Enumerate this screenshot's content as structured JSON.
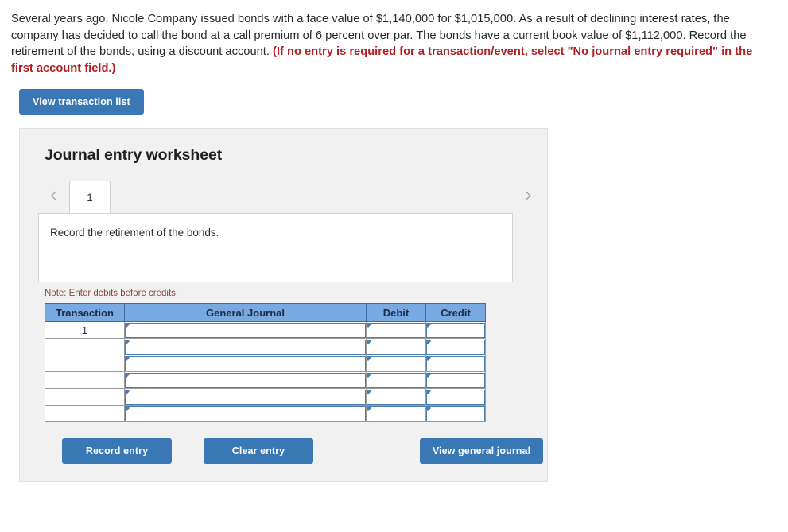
{
  "prompt": {
    "body": "Several years ago, Nicole Company issued bonds with a face value of $1,140,000 for $1,015,000. As a result of declining interest rates, the company has decided to call the bond at a call premium of 6 percent over par. The bonds have a current book value of $1,112,000. Record the retirement of the bonds, using a discount account. ",
    "hint": "(If no entry is required for a transaction/event, select \"No journal entry required\" in the first account field.)"
  },
  "toolbar": {
    "view_transaction_list_label": "View transaction list"
  },
  "worksheet": {
    "title": "Journal entry worksheet",
    "prev_arrow": "‹",
    "next_arrow": "›",
    "tabs": [
      {
        "label": "1",
        "active": true
      }
    ],
    "description": "Record the retirement of the bonds.",
    "note": "Note: Enter debits before credits."
  },
  "table": {
    "headers": [
      "Transaction",
      "General Journal",
      "Debit",
      "Credit"
    ],
    "rows": [
      {
        "transaction": "1",
        "general_journal": "",
        "debit": "",
        "credit": ""
      },
      {
        "transaction": "",
        "general_journal": "",
        "debit": "",
        "credit": ""
      },
      {
        "transaction": "",
        "general_journal": "",
        "debit": "",
        "credit": ""
      },
      {
        "transaction": "",
        "general_journal": "",
        "debit": "",
        "credit": ""
      },
      {
        "transaction": "",
        "general_journal": "",
        "debit": "",
        "credit": ""
      },
      {
        "transaction": "",
        "general_journal": "",
        "debit": "",
        "credit": ""
      }
    ]
  },
  "actions": {
    "record_entry_label": "Record entry",
    "clear_entry_label": "Clear entry",
    "view_general_journal_label": "View general journal"
  },
  "colors": {
    "button_blue": "#3a77b5",
    "header_blue": "#78a9e0",
    "input_border_blue": "#4a7ead",
    "hint_red": "#b01f24",
    "note_brown": "#8a4b3c",
    "panel_gray": "#f1f1f1"
  }
}
